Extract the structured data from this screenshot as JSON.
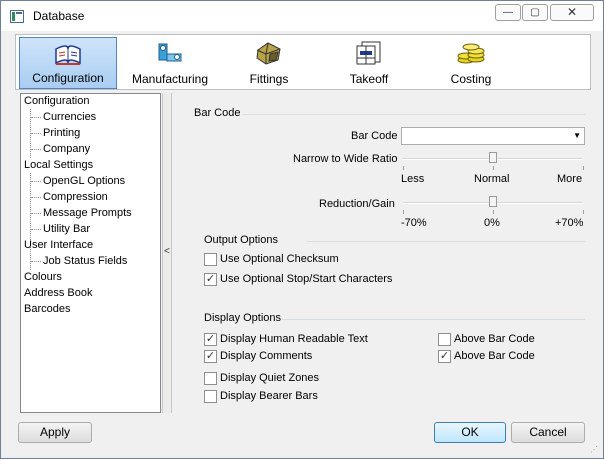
{
  "window": {
    "title": "Database",
    "controls": {
      "minimize": "—",
      "maximize": "▢",
      "close": "✕"
    }
  },
  "toolbar": {
    "items": [
      {
        "label": "Configuration",
        "active": true
      },
      {
        "label": "Manufacturing",
        "active": false
      },
      {
        "label": "Fittings",
        "active": false
      },
      {
        "label": "Takeoff",
        "active": false
      },
      {
        "label": "Costing",
        "active": false
      }
    ]
  },
  "tree": {
    "items": [
      {
        "label": "Configuration",
        "level": 0
      },
      {
        "label": "Currencies",
        "level": 1
      },
      {
        "label": "Printing",
        "level": 1
      },
      {
        "label": "Company",
        "level": 1
      },
      {
        "label": "Local Settings",
        "level": 0
      },
      {
        "label": "OpenGL Options",
        "level": 1
      },
      {
        "label": "Compression",
        "level": 1
      },
      {
        "label": "Message Prompts",
        "level": 1
      },
      {
        "label": "Utility Bar",
        "level": 1
      },
      {
        "label": "User Interface",
        "level": 0
      },
      {
        "label": "Job Status Fields",
        "level": 1
      },
      {
        "label": "Colours",
        "level": 0
      },
      {
        "label": "Address Book",
        "level": 0
      },
      {
        "label": "Barcodes",
        "level": 0
      }
    ]
  },
  "splitter": {
    "glyph": "<"
  },
  "barcode": {
    "section_label": "Bar Code",
    "field_label": "Bar Code",
    "field_value": "",
    "dropdown_arrow": "▼",
    "ratio": {
      "label": "Narrow to Wide Ratio",
      "position": 0.5,
      "min_label": "Less",
      "mid_label": "Normal",
      "max_label": "More"
    },
    "reduction": {
      "label": "Reduction/Gain",
      "position": 0.5,
      "min_label": "-70%",
      "mid_label": "0%",
      "max_label": "+70%"
    }
  },
  "output_options": {
    "title": "Output Options",
    "checksum": {
      "label": "Use Optional Checksum",
      "checked": false
    },
    "stopstart": {
      "label": "Use Optional Stop/Start Characters",
      "checked": true
    }
  },
  "display_options": {
    "title": "Display Options",
    "human_readable": {
      "label": "Display Human Readable Text",
      "checked": true
    },
    "comments": {
      "label": "Display Comments",
      "checked": true
    },
    "quiet_zones": {
      "label": "Display Quiet Zones",
      "checked": false
    },
    "bearer_bars": {
      "label": "Display Bearer Bars",
      "checked": false
    },
    "above_1": {
      "label": "Above Bar Code",
      "checked": false
    },
    "above_2": {
      "label": "Above Bar Code",
      "checked": true
    }
  },
  "buttons": {
    "apply": "Apply",
    "ok": "OK",
    "cancel": "Cancel"
  },
  "check_glyph": "✓"
}
